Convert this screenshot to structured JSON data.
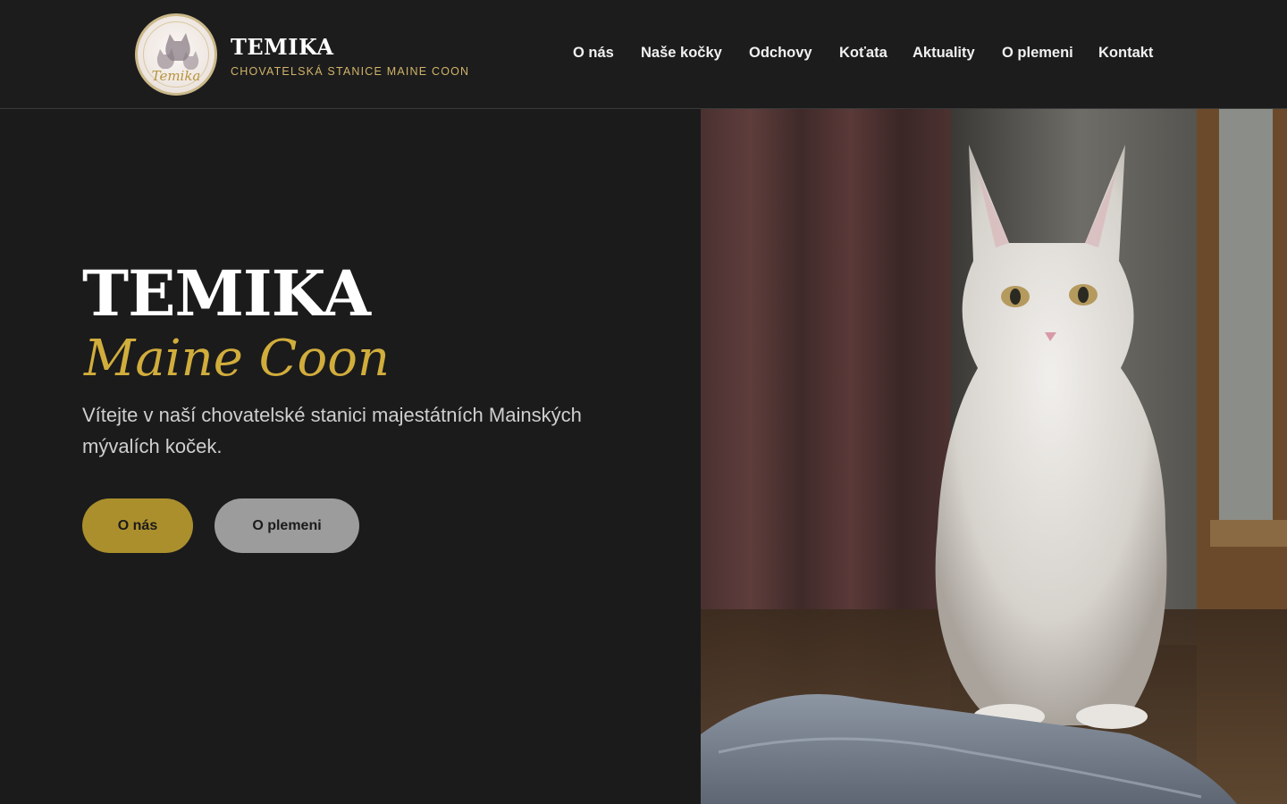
{
  "header": {
    "logo_text": "Temika",
    "brand_title": "TEMIKA",
    "brand_subtitle": "CHOVATELSKÁ STANICE MAINE COON",
    "nav": [
      {
        "label": "O nás"
      },
      {
        "label": "Naše kočky"
      },
      {
        "label": "Odchovy"
      },
      {
        "label": "Koťata"
      },
      {
        "label": "Aktuality"
      },
      {
        "label": "O plemeni"
      },
      {
        "label": "Kontakt"
      }
    ]
  },
  "hero": {
    "title": "TEMIKA",
    "subtitle": "Maine Coon",
    "description": "Vítejte v naší chovatelské stanici majestátních Mainských mývalích koček.",
    "buttons": {
      "primary": "O nás",
      "secondary": "O plemeni"
    },
    "image": "white-maine-coon-kitten-photo"
  },
  "colors": {
    "background": "#1b1b1c",
    "accent_gold": "#d1ad3c",
    "button_gold": "#ab8f2c",
    "button_gray": "#9c9c9c"
  }
}
